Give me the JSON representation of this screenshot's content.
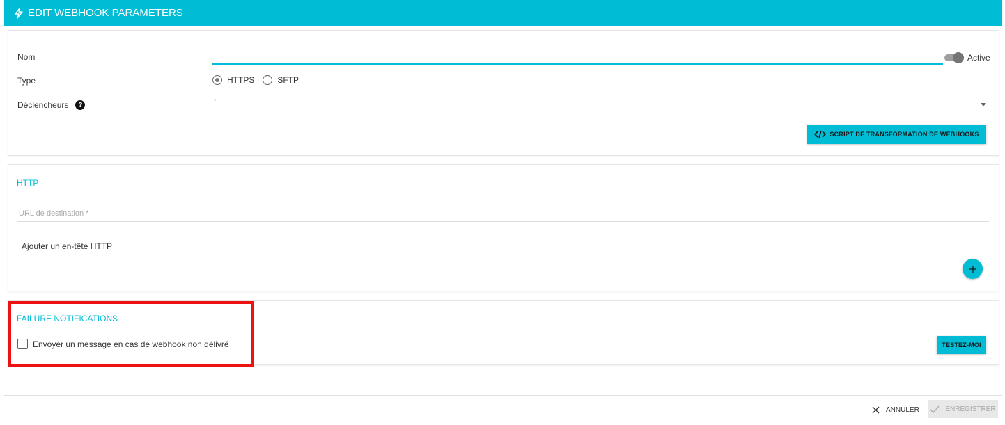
{
  "header": {
    "title": "EDIT WEBHOOK PARAMETERS",
    "icon": "lightning-bolt-icon"
  },
  "general": {
    "name_label": "Nom",
    "name_value": "",
    "active_label": "Active",
    "active_on": true,
    "type_label": "Type",
    "type_options": [
      "HTTPS",
      "SFTP"
    ],
    "type_selected": "HTTPS",
    "triggers_label": "Déclencheurs",
    "triggers_placeholder": "*",
    "script_button": "SCRIPT DE TRANSFORMATION DE WEBHOOKS"
  },
  "http": {
    "title": "HTTP",
    "url_placeholder": "URL de destination *",
    "add_header_label": "Ajouter un en-tête HTTP"
  },
  "failure": {
    "title": "FAILURE NOTIFICATIONS",
    "checkbox_label": "Envoyer un message en cas de webhook non délivré",
    "checked": false,
    "test_button": "TESTEZ-MOI"
  },
  "footer": {
    "cancel_label": "ANNULER",
    "save_label": "ENREGISTRER"
  },
  "colors": {
    "accent": "#00bcd4",
    "highlight": "#ee1111"
  }
}
